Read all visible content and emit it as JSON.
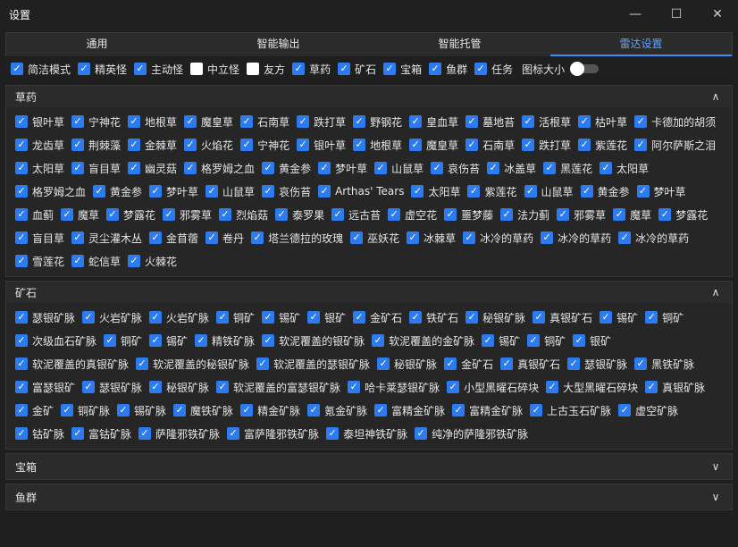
{
  "window": {
    "title": "设置",
    "controls": [
      "minimize-icon",
      "maximize-icon",
      "close-icon"
    ]
  },
  "tabs": [
    {
      "label": "通用",
      "active": false
    },
    {
      "label": "智能输出",
      "active": false
    },
    {
      "label": "智能托管",
      "active": false
    },
    {
      "label": "雷达设置",
      "active": true
    }
  ],
  "options": {
    "items": [
      {
        "label": "简洁模式",
        "checked": true
      },
      {
        "label": "精英怪",
        "checked": true
      },
      {
        "label": "主动怪",
        "checked": true
      },
      {
        "label": "中立怪",
        "checked": false
      },
      {
        "label": "友方",
        "checked": false
      },
      {
        "label": "草药",
        "checked": true
      },
      {
        "label": "矿石",
        "checked": true
      },
      {
        "label": "宝箱",
        "checked": true
      },
      {
        "label": "鱼群",
        "checked": true
      },
      {
        "label": "任务",
        "checked": true
      }
    ],
    "icon_size_label": "图标大小",
    "icon_size_value": 0
  },
  "herbs": {
    "title": "草药",
    "expanded": true,
    "items": [
      "银叶草",
      "宁神花",
      "地根草",
      "魔皇草",
      "石南草",
      "跌打草",
      "野钢花",
      "皇血草",
      "墓地苔",
      "活根草",
      "枯叶草",
      "卡德加的胡须",
      "龙齿草",
      "荆棘藻",
      "金棘草",
      "火焰花",
      "宁神花",
      "银叶草",
      "地根草",
      "魔皇草",
      "石南草",
      "跌打草",
      "紫莲花",
      "阿尔萨斯之泪",
      "太阳草",
      "盲目草",
      "幽灵菇",
      "格罗姆之血",
      "黄金参",
      "梦叶草",
      "山鼠草",
      "哀伤苔",
      "冰盖草",
      "黑莲花",
      "太阳草",
      "格罗姆之血",
      "黄金参",
      "梦叶草",
      "山鼠草",
      "哀伤苔",
      "Arthas' Tears",
      "太阳草",
      "紫莲花",
      "山鼠草",
      "黄金参",
      "梦叶草",
      "血蓟",
      "魔草",
      "梦露花",
      "邪雾草",
      "烈焰菇",
      "泰罗果",
      "远古苔",
      "虚空花",
      "噩梦藤",
      "法力蓟",
      "邪雾草",
      "魔草",
      "梦露花",
      "盲目草",
      "灵尘灌木丛",
      "金苜蓿",
      "卷丹",
      "塔兰德拉的玫瑰",
      "巫妖花",
      "冰棘草",
      "冰冷的草药",
      "冰冷的草药",
      "冰冷的草药",
      "雪莲花",
      "蛇信草",
      "火棘花"
    ]
  },
  "ores": {
    "title": "矿石",
    "expanded": true,
    "items": [
      "瑟银矿脉",
      "火岩矿脉",
      "火岩矿脉",
      "铜矿",
      "锡矿",
      "银矿",
      "金矿石",
      "铁矿石",
      "秘银矿脉",
      "真银矿石",
      "锡矿",
      "铜矿",
      "次级血石矿脉",
      "铜矿",
      "锡矿",
      "精铁矿脉",
      "软泥覆盖的银矿脉",
      "软泥覆盖的金矿脉",
      "锡矿",
      "铜矿",
      "银矿",
      "软泥覆盖的真银矿脉",
      "软泥覆盖的秘银矿脉",
      "软泥覆盖的瑟银矿脉",
      "秘银矿脉",
      "金矿石",
      "真银矿石",
      "瑟银矿脉",
      "黑铁矿脉",
      "富瑟银矿",
      "瑟银矿脉",
      "秘银矿脉",
      "软泥覆盖的富瑟银矿脉",
      "哈卡莱瑟银矿脉",
      "小型黑曜石碎块",
      "大型黑曜石碎块",
      "真银矿脉",
      "金矿",
      "铜矿脉",
      "锡矿脉",
      "魔铁矿脉",
      "精金矿脉",
      "氪金矿脉",
      "富精金矿脉",
      "富精金矿脉",
      "上古玉石矿脉",
      "虚空矿脉",
      "钴矿脉",
      "富钴矿脉",
      "萨隆邪铁矿脉",
      "富萨隆邪铁矿脉",
      "泰坦神铁矿脉",
      "纯净的萨隆邪铁矿脉"
    ]
  },
  "chests": {
    "title": "宝箱",
    "expanded": false
  },
  "fish": {
    "title": "鱼群",
    "expanded": false
  }
}
